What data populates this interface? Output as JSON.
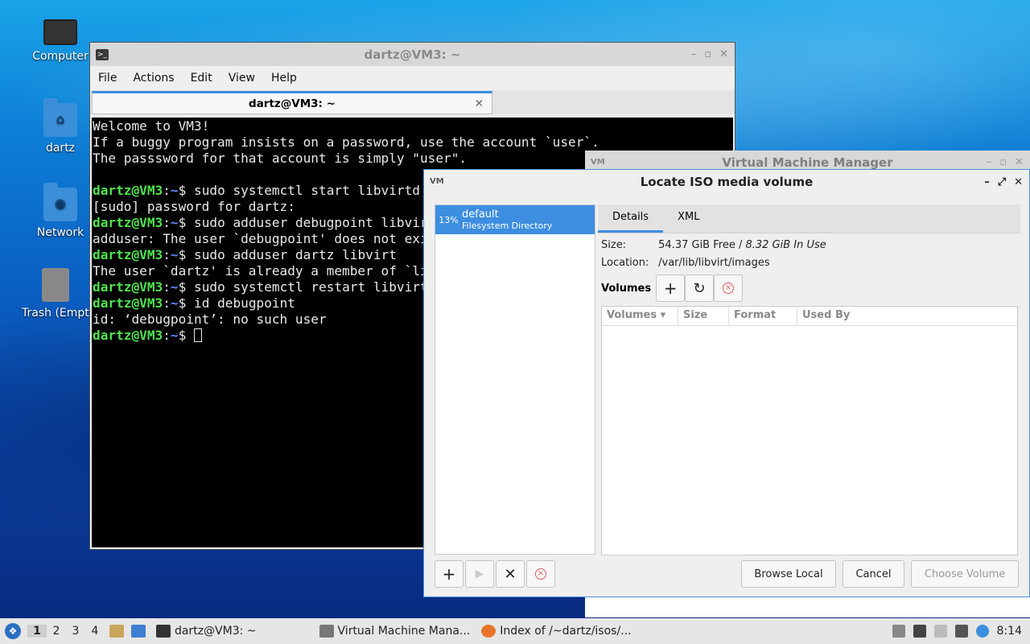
{
  "desktop": {
    "icons": [
      {
        "label": "Computer"
      },
      {
        "label": "dartz"
      },
      {
        "label": "Network"
      },
      {
        "label": "Trash (Empty)"
      }
    ]
  },
  "terminal": {
    "title": "dartz@VM3: ~",
    "menu": [
      "File",
      "Actions",
      "Edit",
      "View",
      "Help"
    ],
    "tab_title": "dartz@VM3: ~",
    "lines": [
      {
        "text": "Welcome to VM3!"
      },
      {
        "text": "If a buggy program insists on a password, use the account `user`."
      },
      {
        "text": "The passsword for that account is simply \"user\"."
      },
      {
        "text": ""
      },
      {
        "prompt": "dartz@VM3",
        "dir": "~",
        "cmd": "$ sudo systemctl start libvirtd"
      },
      {
        "text": "[sudo] password for dartz:"
      },
      {
        "prompt": "dartz@VM3",
        "dir": "~",
        "cmd": "$ sudo adduser debugpoint libvirt"
      },
      {
        "text": "adduser: The user `debugpoint' does not exist."
      },
      {
        "prompt": "dartz@VM3",
        "dir": "~",
        "cmd": "$ sudo adduser dartz libvirt"
      },
      {
        "text": "The user `dartz' is already a member of `libvirt'."
      },
      {
        "prompt": "dartz@VM3",
        "dir": "~",
        "cmd": "$ sudo systemctl restart libvirtd"
      },
      {
        "prompt": "dartz@VM3",
        "dir": "~",
        "cmd": "$ id debugpoint"
      },
      {
        "text": "id: ‘debugpoint’: no such user"
      },
      {
        "prompt": "dartz@VM3",
        "dir": "~",
        "cmd": "$ ",
        "cursor": true
      }
    ]
  },
  "vmm": {
    "title": "Virtual Machine Manager"
  },
  "dialog": {
    "title": "Locate ISO media volume",
    "pool": {
      "percent": "13%",
      "name": "default",
      "type": "Filesystem Directory"
    },
    "tabs": [
      "Details",
      "XML"
    ],
    "size_label": "Size:",
    "size_free": "54.37 GiB Free / ",
    "size_used": "8.32 GiB In Use",
    "location_label": "Location:",
    "location_value": "/var/lib/libvirt/images",
    "volumes_label": "Volumes",
    "columns": [
      "Volumes",
      "Size",
      "Format",
      "Used By"
    ],
    "buttons": {
      "browse": "Browse Local",
      "cancel": "Cancel",
      "choose": "Choose Volume"
    }
  },
  "taskbar": {
    "workspaces": [
      "1",
      "2",
      "3",
      "4"
    ],
    "tasks": [
      {
        "label": "dartz@VM3: ~"
      },
      {
        "label": "Virtual Machine Mana..."
      },
      {
        "label": "Index of /~dartz/isos/..."
      }
    ],
    "clock": "8:14"
  }
}
